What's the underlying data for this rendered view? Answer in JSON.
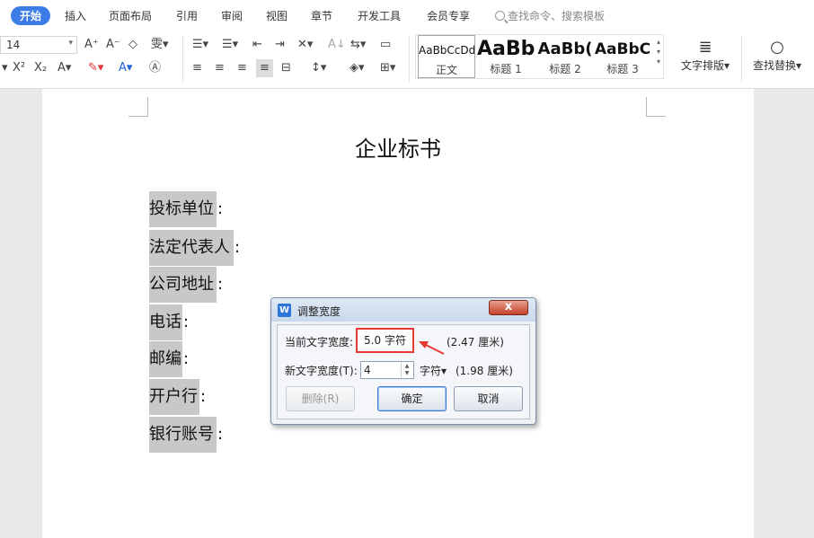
{
  "tabs": [
    "开始",
    "插入",
    "页面布局",
    "引用",
    "审阅",
    "视图",
    "章节",
    "开发工具",
    "会员专享"
  ],
  "search_placeholder": "查找命令、搜索模板",
  "font_size": "14",
  "styles": [
    {
      "sample": "AaBbCcDd",
      "label": "正文"
    },
    {
      "sample": "AaBb",
      "label": "标题 1"
    },
    {
      "sample": "AaBb(",
      "label": "标题 2"
    },
    {
      "sample": "AaBbC",
      "label": "标题 3"
    }
  ],
  "tools": {
    "text_layout": "文字排版",
    "find_replace": "查找替换"
  },
  "document": {
    "title": "企业标书",
    "fields": [
      "投标单位",
      "法定代表人",
      "公司地址",
      "电话",
      "邮编",
      "开户行",
      "银行账号"
    ],
    "colon": ":"
  },
  "dialog": {
    "title": "调整宽度",
    "close": "x",
    "current_label": "当前文字宽度:",
    "current_value": "5.0 字符",
    "current_cm": "(2.47 厘米)",
    "new_label": "新文字宽度(T):",
    "new_value": "4",
    "unit": "字符",
    "new_cm": "(1.98 厘米)",
    "delete_btn": "删除(R)",
    "ok_btn": "确定",
    "cancel_btn": "取消"
  },
  "colors": {
    "accent": "#3c7ce7",
    "highlight_box": "#e53935",
    "field_shade": "#c8c8c8"
  }
}
